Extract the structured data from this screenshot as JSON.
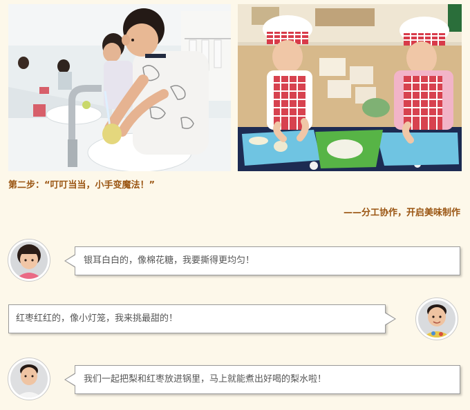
{
  "step": {
    "title": "第二步：“叮叮当当，小手变魔法！”",
    "subtitle": "——分工协作，开启美味制作"
  },
  "photos": [
    {
      "icon": "children-washing-pears-photo"
    },
    {
      "icon": "children-cutting-pears-photo"
    }
  ],
  "dialogue": [
    {
      "side": "left",
      "text": "银耳白白的，像棉花糖，我要撕得更均匀！",
      "avatar": "girl-avatar"
    },
    {
      "side": "right",
      "text": "红枣红红的，像小灯笼，我来挑最甜的！",
      "avatar": "boy-avatar"
    },
    {
      "side": "left",
      "text": "我们一起把梨和红枣放进锅里，马上就能煮出好喝的梨水啦！",
      "avatar": "boy-avatar"
    }
  ],
  "colors": {
    "background": "#fdf8ea",
    "heading": "#9a5512",
    "bubble_text": "#555555",
    "bubble_border": "#9a9a9a"
  }
}
